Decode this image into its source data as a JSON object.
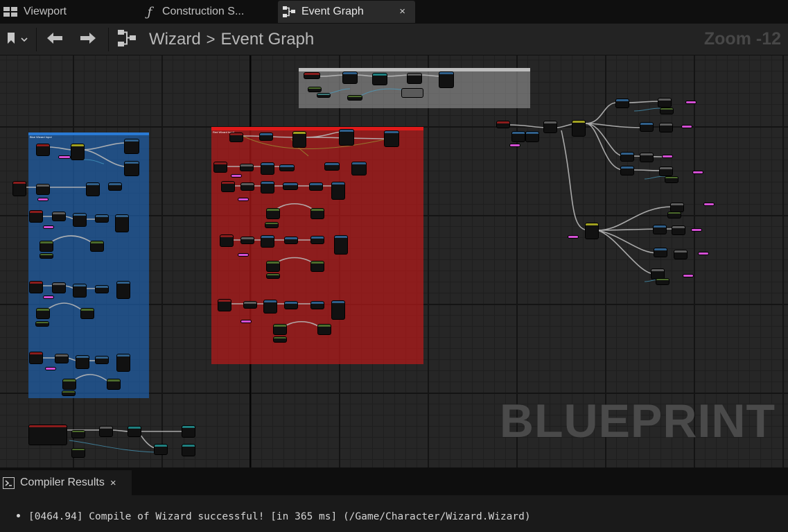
{
  "tabs": [
    {
      "label": "Viewport",
      "icon": "viewport-grid-icon",
      "active": false
    },
    {
      "label": "Construction S...",
      "icon": "function-icon",
      "active": false
    },
    {
      "label": "Event Graph",
      "icon": "graph-icon",
      "active": true
    }
  ],
  "tab_close_glyph": "×",
  "breadcrumb": {
    "root": "Wizard",
    "separator": ">",
    "current": "Event Graph"
  },
  "zoom_label": "Zoom -12",
  "graph": {
    "watermark": "BLUEPRINT",
    "comments": [
      {
        "label": "Blue Wizard Input",
        "color": "#1e64b4"
      },
      {
        "label": "Red Wizard Input",
        "color": "#c01a1a"
      },
      {
        "label": "",
        "color": "#9a9a9a"
      }
    ]
  },
  "compiler_panel": {
    "title": "Compiler Results",
    "close_glyph": "×",
    "messages": [
      "[0464.94] Compile of Wizard successful! [in 365 ms] (/Game/Character/Wizard.Wizard)"
    ]
  },
  "colors": {
    "exec_wire": "#bdbdbd",
    "event_node": "#8a1c1c",
    "function_node": "#2f5f8a",
    "pure_node": "#4c6b2c",
    "variable_pin": "#d44fd4",
    "accent": "#d8b400"
  }
}
